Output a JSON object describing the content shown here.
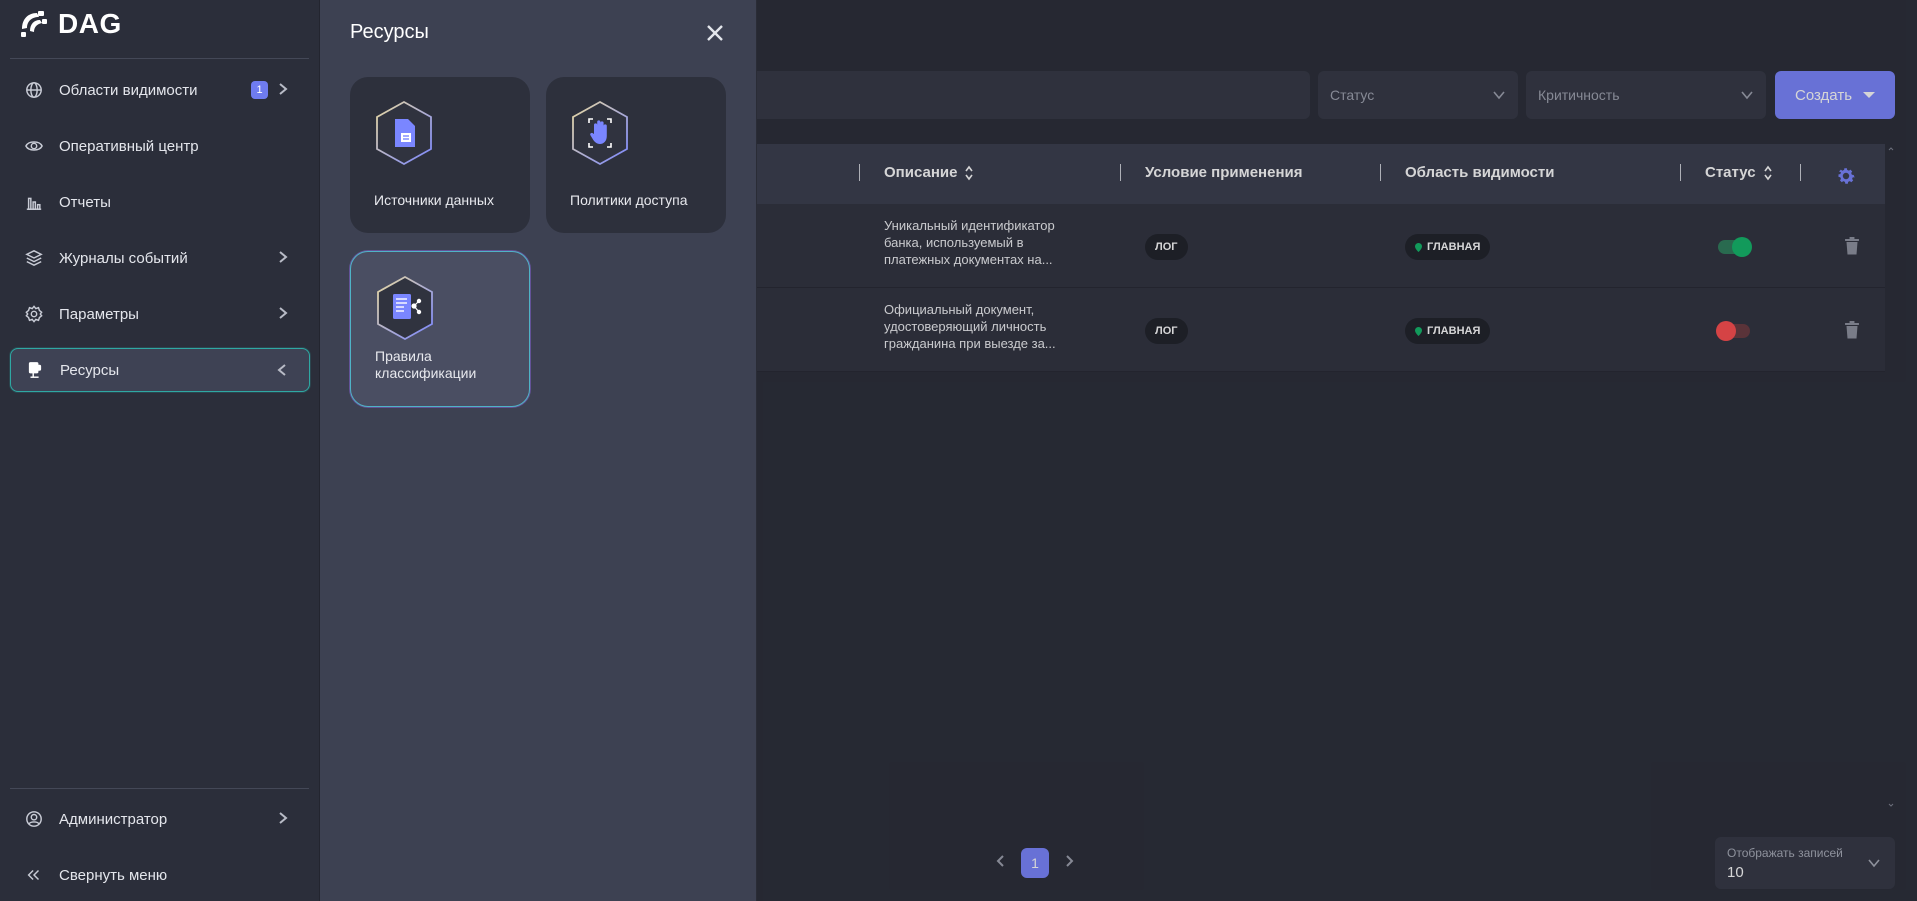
{
  "app": {
    "name": "DAG"
  },
  "sidebar": {
    "items": [
      {
        "label": "Области видимости",
        "badge": "1"
      },
      {
        "label": "Оперативный центр"
      },
      {
        "label": "Отчеты"
      },
      {
        "label": "Журналы событий"
      },
      {
        "label": "Параметры"
      },
      {
        "label": "Ресурсы"
      }
    ],
    "footer": [
      {
        "label": "Администратор"
      },
      {
        "label": "Свернуть меню"
      }
    ]
  },
  "flyout": {
    "title": "Ресурсы",
    "cards": [
      {
        "label": "Источники данных",
        "icon": "document-file-icon"
      },
      {
        "label": "Политики доступа",
        "icon": "hand-stop-icon"
      },
      {
        "label": "Правила классификации",
        "icon": "list-share-icon"
      }
    ]
  },
  "filters": {
    "status": "Статус",
    "criticality": "Критичность",
    "create_label": "Создать"
  },
  "table": {
    "columns": [
      {
        "label": "Описание",
        "sortable": true
      },
      {
        "label": "Условие применения",
        "sortable": false
      },
      {
        "label": "Область видимости",
        "sortable": false
      },
      {
        "label": "Статус",
        "sortable": true
      }
    ],
    "rows": [
      {
        "description": [
          "Уникальный идентификатор",
          "банка, используемый в",
          "платежных документах на..."
        ],
        "condition": "ЛОГ",
        "scope": "ГЛАВНАЯ",
        "enabled": true
      },
      {
        "description": [
          "Официальный документ,",
          "удостоверяющий личность",
          "гражданина при выезде за..."
        ],
        "condition": "ЛОГ",
        "scope": "ГЛАВНАЯ",
        "enabled": false
      }
    ]
  },
  "pagination": {
    "current_page": "1",
    "per_page_label": "Отображать записей",
    "per_page_value": "10"
  },
  "colors": {
    "accent": "#7a86ff",
    "toggle_on": "#12b76a",
    "toggle_off": "#ff4d4f",
    "active_border": "#2fa8a3"
  }
}
